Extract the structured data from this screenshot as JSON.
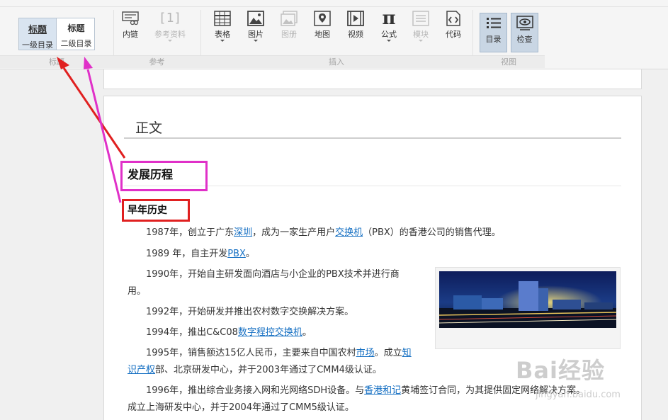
{
  "toolbar": {
    "heading_group": {
      "label": "标题",
      "h1": {
        "top": "标题",
        "bottom": "一级目录"
      },
      "h2": {
        "top": "标题",
        "bottom": "二级目录"
      }
    },
    "ref_group": {
      "label": "参考",
      "inline_link": "内链",
      "reference": {
        "icon_text": "[1]",
        "label": "参考资料"
      }
    },
    "insert_group": {
      "label": "插入",
      "table": "表格",
      "image": "图片",
      "album": "图册",
      "map": "地图",
      "video": "视频",
      "formula": {
        "icon_text": "π",
        "label": "公式"
      },
      "module": "模块",
      "code": "代码"
    },
    "view_group": {
      "label": "视图",
      "toc": "目录",
      "check": "检查"
    }
  },
  "document": {
    "section_title": "正文",
    "h2": "发展历程",
    "h3": "早年历史",
    "paragraphs": {
      "p1": {
        "a": "1987年，创立于广东",
        "link1": "深圳",
        "b": "，成为一家生产用户",
        "link2": "交换机",
        "c": "（PBX）的香港公司的销售代理。"
      },
      "p2": {
        "a": "1989 年，自主开发",
        "link1": "PBX",
        "b": "。"
      },
      "p3": {
        "line1": "1990年，开始自主研发面向酒店与小企业的PBX技术并进行商",
        "line2": "用。"
      },
      "p4": {
        "a": "1992年，开始研发并推出农村数字交换解决方案。"
      },
      "p5": {
        "a": "1994年，推出C&C08",
        "link1": "数字程控交换机",
        "b": "。"
      },
      "p6": {
        "a": "1995年，销售额达15亿人民币，主要来自中国农村",
        "link1": "市场",
        "b": "。成立",
        "link2a": "知",
        "link2b": "识产权",
        "c": "部、北京研发中心，并于2003年通过了CMM4级认证。"
      },
      "p7": {
        "a": "1996年，推出综合业务接入网和光网络SDH设备。与",
        "link1": "香港和记",
        "b": "黄埔签订合同，为其提供固定网络解决方案。",
        "line2": "成立上海研发中心，并于2004年通过了CMM5级认证。"
      }
    }
  },
  "watermark": {
    "main": "Bai经验",
    "sub": "jingyan.baidu.com"
  },
  "colors": {
    "link": "#136ec2",
    "annot_red": "#e02020",
    "annot_magenta": "#e030c8"
  }
}
